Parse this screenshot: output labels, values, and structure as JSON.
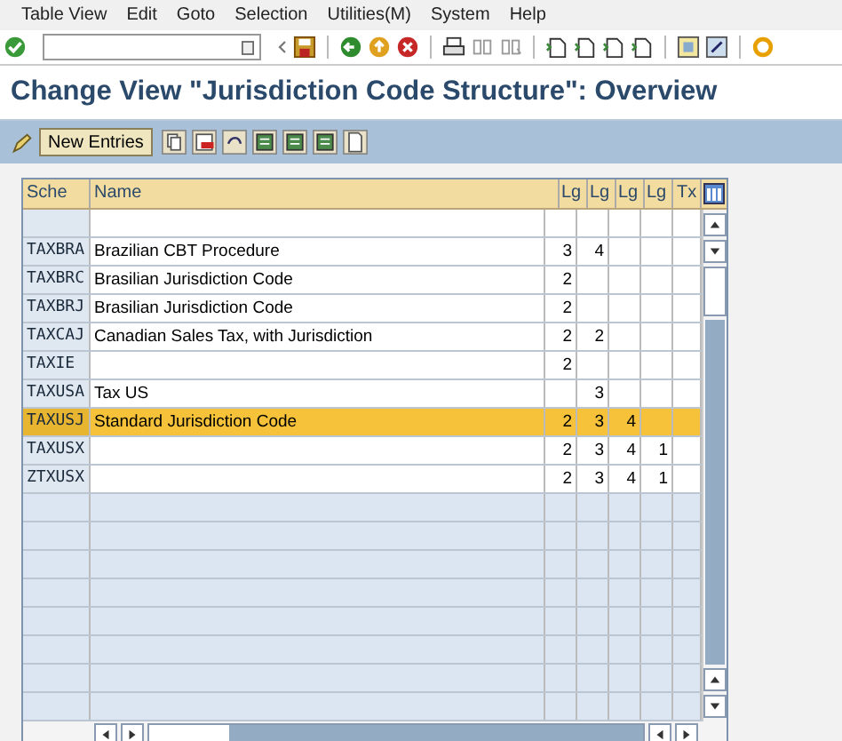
{
  "menu": [
    "Table View",
    "Edit",
    "Goto",
    "Selection",
    "Utilities(M)",
    "System",
    "Help"
  ],
  "title": "Change View \"Jurisdiction Code Structure\": Overview",
  "app_toolbar": {
    "button": "New Entries"
  },
  "table": {
    "columns": [
      "Sche",
      "Name",
      "Lg",
      "Lg",
      "Lg",
      "Lg",
      "Tx"
    ],
    "rows": [
      {
        "selected": false
      },
      {
        "scheme": "TAXBRA",
        "name": "Brazilian CBT Procedure",
        "lg_1": "3",
        "lg_2": "4",
        "selected": false
      },
      {
        "scheme": "TAXBRC",
        "name": "Brasilian Jurisdiction Code",
        "lg_1": "2",
        "selected": false
      },
      {
        "scheme": "TAXBRJ",
        "name": "Brasilian Jurisdiction Code",
        "lg_1": "2",
        "selected": false
      },
      {
        "scheme": "TAXCAJ",
        "name": "Canadian Sales Tax, with Jurisdiction",
        "lg_1": "2",
        "lg_2": "2",
        "selected": false
      },
      {
        "scheme": "TAXIE",
        "lg_1": "2",
        "selected": false
      },
      {
        "scheme": "TAXUSA",
        "name": "Tax US",
        "lg_2": "3",
        "selected": false
      },
      {
        "scheme": "TAXUSJ",
        "name": "Standard Jurisdiction Code",
        "lg_1": "2",
        "lg_2": "3",
        "lg_3": "4",
        "selected": true
      },
      {
        "scheme": "TAXUSX",
        "lg_1": "2",
        "lg_2": "3",
        "lg_3": "4",
        "lg_4": "1",
        "selected": false
      },
      {
        "scheme": "ZTXUSX",
        "lg_1": "2",
        "lg_2": "3",
        "lg_3": "4",
        "lg_4": "1",
        "selected": false
      }
    ]
  }
}
